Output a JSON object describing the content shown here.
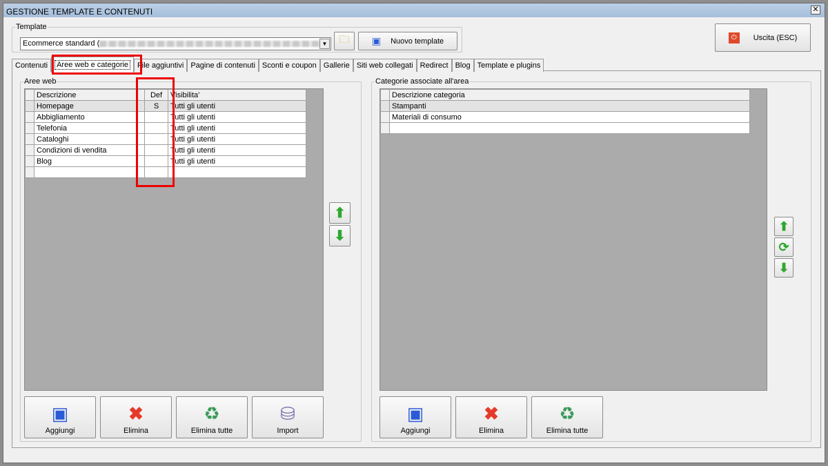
{
  "window": {
    "title": "GESTIONE TEMPLATE E CONTENUTI",
    "close": "✕"
  },
  "template": {
    "legend": "Template",
    "value": "Ecommerce standard (",
    "new_label": "Nuovo template"
  },
  "exit_label": "Uscita (ESC)",
  "tabs": [
    "Contenuti",
    "Aree web e categorie",
    "File aggiuntivi",
    "Pagine di contenuti",
    "Sconti e coupon",
    "Gallerie",
    "Siti web collegati",
    "Redirect",
    "Blog",
    "Template e plugins"
  ],
  "aree": {
    "legend": "Aree web",
    "headers": [
      "Descrizione",
      "Def",
      "Visibilita'"
    ],
    "rows": [
      [
        "Homepage",
        "S",
        "Tutti gli utenti"
      ],
      [
        "Abbigliamento",
        "",
        "Tutti gli utenti"
      ],
      [
        "Telefonia",
        "",
        "Tutti gli utenti"
      ],
      [
        "Cataloghi",
        "",
        "Tutti gli utenti"
      ],
      [
        "Condizioni di vendita",
        "",
        "Tutti gli utenti"
      ],
      [
        "Blog",
        "",
        "Tutti gli utenti"
      ]
    ],
    "buttons": [
      "Aggiungi",
      "Elimina",
      "Elimina tutte",
      "Import"
    ]
  },
  "categorie": {
    "legend": "Categorie associate all'area",
    "header": "Descrizione categoria",
    "rows": [
      "Stampanti",
      "Materiali di consumo"
    ],
    "buttons": [
      "Aggiungi",
      "Elimina",
      "Elimina tutte"
    ]
  }
}
